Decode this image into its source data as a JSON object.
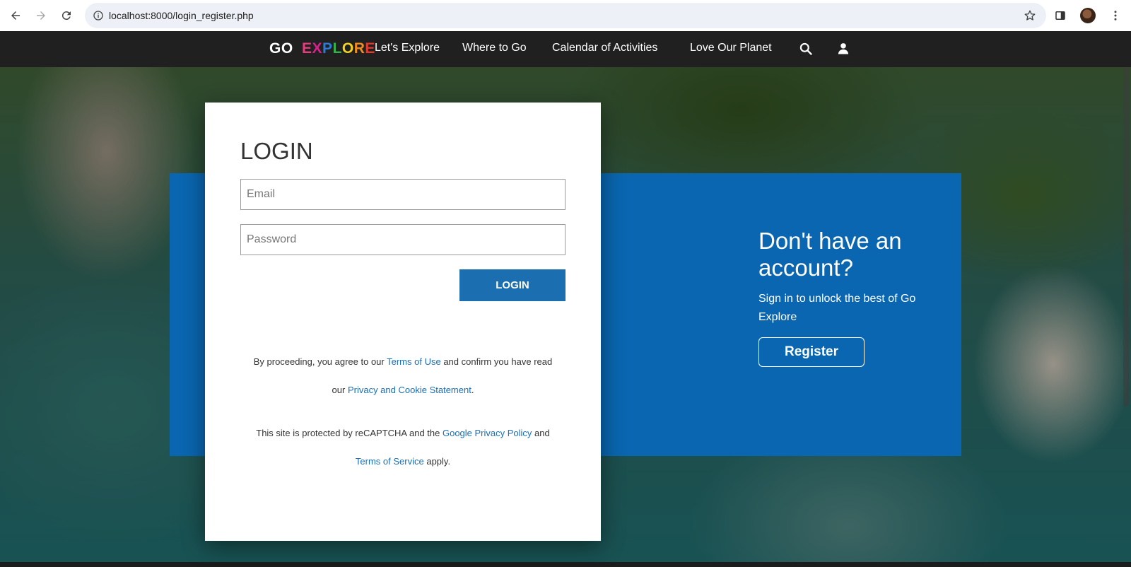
{
  "browser": {
    "url": "localhost:8000/login_register.php",
    "icons": [
      "back-icon",
      "forward-icon",
      "reload-icon",
      "site-info-icon",
      "bookmark-star-icon",
      "side-panel-icon",
      "profile-avatar",
      "more-menu-icon"
    ]
  },
  "site_nav": {
    "logo_go": "GO",
    "logo_explore_letters": [
      "E",
      "X",
      "P",
      "L",
      "O",
      "R",
      "E"
    ],
    "logo_explore_colors": [
      "#e63c7d",
      "#d7208c",
      "#2c7ad6",
      "#34b14a",
      "#f4d21f",
      "#f28a1e",
      "#e23a2c"
    ],
    "items": [
      "Let's Explore",
      "Where to Go",
      "Calendar of Activities",
      "Love Our Planet"
    ],
    "icons": [
      "search-icon",
      "user-icon"
    ]
  },
  "login": {
    "title": "LOGIN",
    "email_placeholder": "Email",
    "password_placeholder": "Password",
    "button": "LOGIN",
    "legal1_pre": "By proceeding, you agree to our ",
    "legal1_link1": "Terms of Use",
    "legal1_mid": " and confirm you have read",
    "legal1_pre2": "our ",
    "legal1_link2": "Privacy and Cookie Statement",
    "legal1_end": ".",
    "legal2_pre": "This site is protected by reCAPTCHA and the ",
    "legal2_link1": "Google Privacy Policy",
    "legal2_mid": " and",
    "legal2_link2": "Terms of Service",
    "legal2_end": " apply."
  },
  "register": {
    "title": "Don't have an account?",
    "subtitle": "Sign in to unlock the best of Go Explore",
    "button": "Register"
  },
  "colors": {
    "panel_blue": "#0a66b0",
    "button_blue": "#1b6fb0",
    "link_blue": "#1a6fb5",
    "nav_bg": "#202020"
  }
}
